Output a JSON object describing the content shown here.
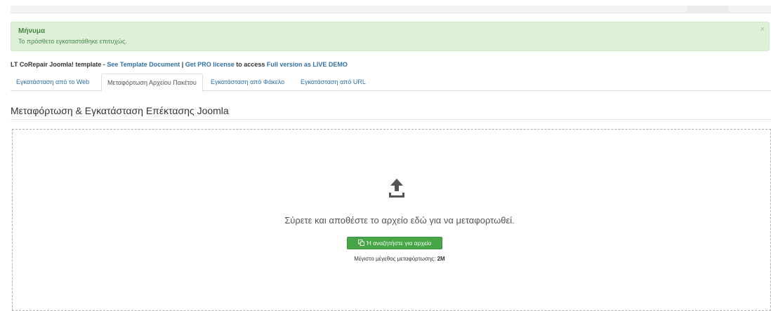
{
  "alert": {
    "heading": "Μήνυμα",
    "text": "Το πρόσθετο εγκαταστάθηκε επιτυχώς.",
    "close": "×",
    "color": "#dff0d8"
  },
  "promo": {
    "prefix": "LT CoRepair Joomla! template - ",
    "template_doc_link": "See Template Document",
    "separator": " | ",
    "pro_link": "Get PRO license",
    "middle": " to access ",
    "demo_link": "Full version as LIVE DEMO"
  },
  "tabs": [
    {
      "label": "Εγκατάσταση από το Web",
      "active": false
    },
    {
      "label": "Μεταφόρτωση Αρχείου Πακέτου",
      "active": true
    },
    {
      "label": "Εγκατάσταση από Φάκελο",
      "active": false
    },
    {
      "label": "Εγκατάσταση από URL",
      "active": false
    }
  ],
  "section": {
    "title": "Μεταφόρτωση & Εγκατάσταση Επέκτασης Joomla"
  },
  "dropzone": {
    "icon": "upload-icon",
    "text": "Σύρετε και αποθέστε το αρχείο εδώ για να μεταφορτωθεί.",
    "button_label": "Ή αναζητήστε για αρχείο",
    "button_icon": "copy-icon",
    "button_color": "#46a546",
    "max_size_label": "Μέγιστο μέγεθος μεταφόρτωσης:",
    "max_size_value": "2M"
  }
}
